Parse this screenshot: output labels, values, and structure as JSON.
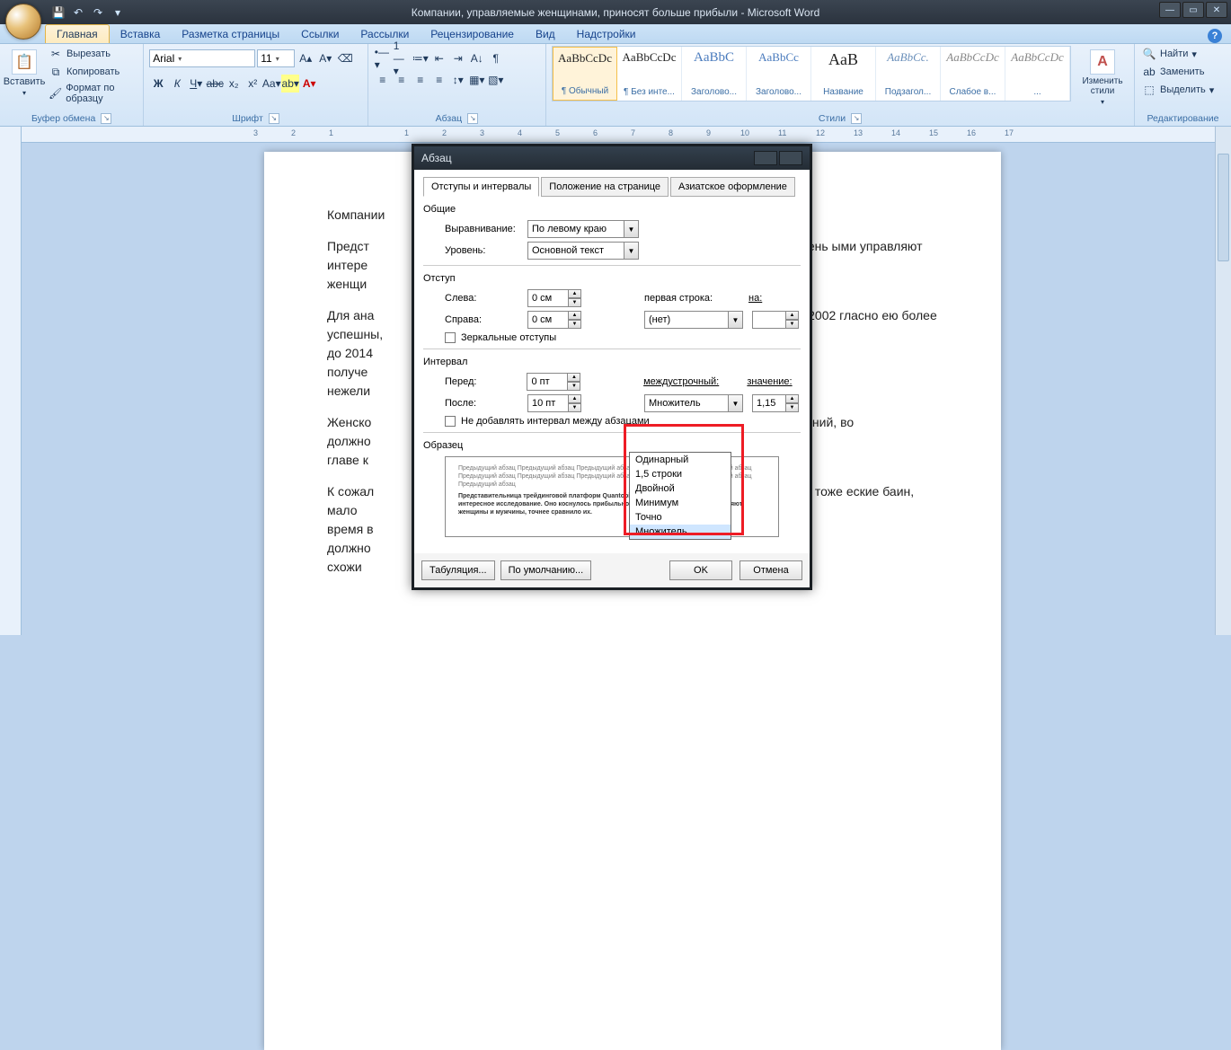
{
  "app": {
    "title": "Компании, управляемые женщинами, приносят больше прибыли - Microsoft Word"
  },
  "qat": {
    "save": "💾",
    "undo": "↶",
    "redo": "↷"
  },
  "ribbonTabs": [
    "Главная",
    "Вставка",
    "Разметка страницы",
    "Ссылки",
    "Рассылки",
    "Рецензирование",
    "Вид",
    "Надстройки"
  ],
  "ribbonSelectedTab": 0,
  "groups": {
    "clipboard": {
      "paste": "Вставить",
      "cut": "Вырезать",
      "copy": "Копировать",
      "formatPainter": "Формат по образцу",
      "title": "Буфер обмена"
    },
    "font": {
      "name": "Arial",
      "size": "11",
      "title": "Шрифт"
    },
    "paragraph": {
      "title": "Абзац"
    },
    "styles": {
      "title": "Стили",
      "changeStyles": "Изменить стили",
      "items": [
        {
          "preview": "AaBbCcDc",
          "label": "¶ Обычный"
        },
        {
          "preview": "AaBbCcDc",
          "label": "¶ Без инте..."
        },
        {
          "preview": "AaBbC",
          "label": "Заголово..."
        },
        {
          "preview": "AaBbCc",
          "label": "Заголово..."
        },
        {
          "preview": "AaB",
          "label": "Название"
        },
        {
          "preview": "AaBbCc.",
          "label": "Подзагол..."
        },
        {
          "preview": "AaBbCcDc",
          "label": "Слабое в..."
        },
        {
          "preview": "AaBbCcDc",
          "label": "..."
        }
      ]
    },
    "editing": {
      "find": "Найти",
      "replace": "Заменить",
      "select": "Выделить",
      "title": "Редактирование"
    }
  },
  "document": {
    "p1": "Компании",
    "p2": "Предст… интере… женщи…",
    "p2_right": "елала очень ыми управляют",
    "p3": "Для ана… до 2014… получе… нежели…",
    "p3_right": "ериод от 2002 гласно ею более успешны,",
    "p4": "Женско… должнс… главе к…",
    "p4_right": "ие к компаний, во",
    "p5": "К сожал… время в… должнс… схожи …",
    "p5_right": "ор США. В тоже еские баин, мало"
  },
  "dialog": {
    "title": "Абзац",
    "tabs": [
      "Отступы и интервалы",
      "Положение на странице",
      "Азиатское оформление"
    ],
    "selectedTab": 0,
    "sections": {
      "general": "Общие",
      "indent": "Отступ",
      "spacing": "Интервал",
      "preview": "Образец"
    },
    "labels": {
      "alignment": "Выравнивание:",
      "level": "Уровень:",
      "left": "Слева:",
      "right": "Справа:",
      "mirror": "Зеркальные отступы",
      "before": "Перед:",
      "after": "После:",
      "firstLine": "первая строка:",
      "on": "на:",
      "lineSpacing": "междустрочный:",
      "value": "значение:",
      "noAdd": "Не добавлять интервал между абзацами"
    },
    "values": {
      "alignment": "По левому краю",
      "level": "Основной текст",
      "left": "0 см",
      "right": "0 см",
      "firstLine": "(нет)",
      "before": "0 пт",
      "after": "10 пт",
      "lineSpacing": "Множитель",
      "spacingValue": "1,15"
    },
    "lineSpacingOptions": [
      "Одинарный",
      "1,5 строки",
      "Двойной",
      "Минимум",
      "Точно",
      "Множитель"
    ],
    "previewText1": "Предыдущий абзац Предыдущий абзац Предыдущий абзац Предыдущий абзац Предыдущий абзац Предыдущий абзац Предыдущий абзац Предыдущий абзац Предыдущий абзац Предыдущий абзац Предыдущий абзац",
    "previewText2": "Представительница трейдинговой платформ Quantopian Карин Рабаин сделала очень интересное исследование. Оно коснулось прибыльности компаний, которыми управляют женщины и мужчины, точнее сравнило их.",
    "buttons": {
      "tabs": "Табуляция...",
      "default": "По умолчанию...",
      "ok": "OK",
      "cancel": "Отмена"
    }
  }
}
